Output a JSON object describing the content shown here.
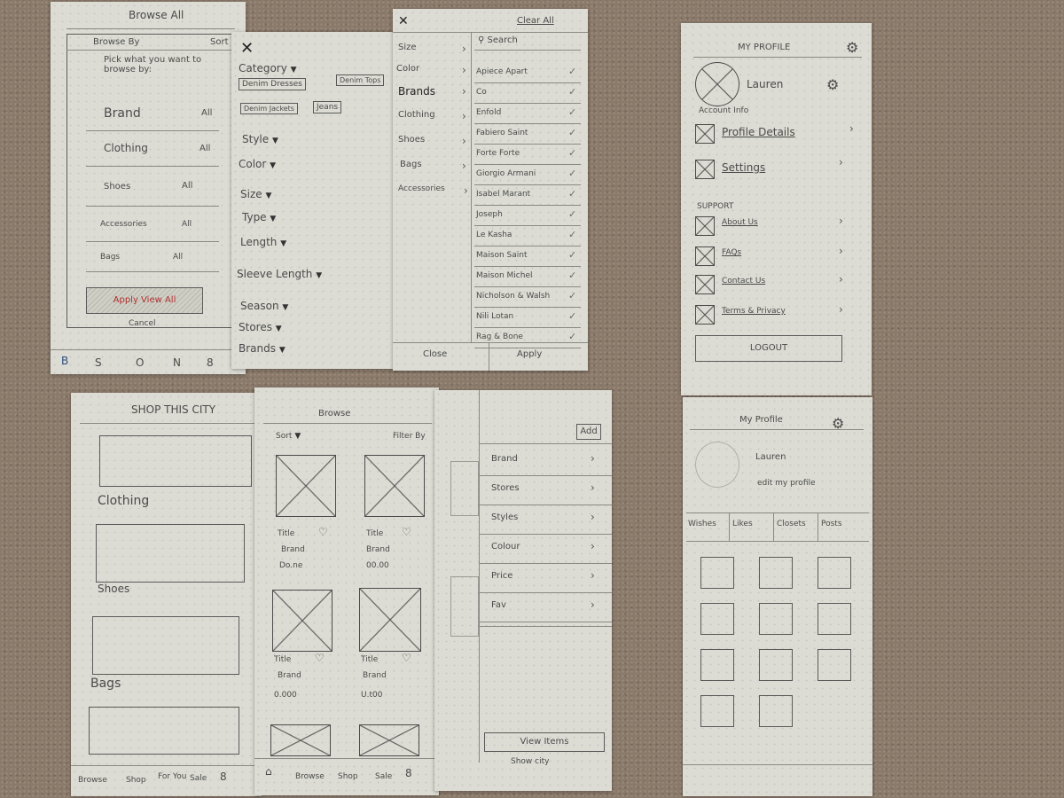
{
  "browse_all": {
    "title": "Browse All",
    "tab_left": "Browse By",
    "tab_right": "Sort",
    "intro": "Pick what you want to browse by:",
    "rows": [
      {
        "label": "Brand",
        "value": "All"
      },
      {
        "label": "Clothing",
        "value": "All"
      },
      {
        "label": "Shoes",
        "value": "All"
      },
      {
        "label": "Accessories",
        "value": "All"
      },
      {
        "label": "Bags",
        "value": "All"
      }
    ],
    "apply": "Apply View All",
    "cancel": "Cancel",
    "bottom_nav": [
      "B",
      "S",
      "O",
      "N",
      "8"
    ]
  },
  "filters": {
    "close_icon": "close-icon",
    "category": "Category",
    "chips": [
      "Denim Dresses",
      "Denim Tops",
      "Denim Jackets",
      "Jeans"
    ],
    "items": [
      "Style",
      "Color",
      "Size",
      "Type",
      "Length",
      "Sleeve Length",
      "Season",
      "Stores",
      "Brands"
    ]
  },
  "brand_picker": {
    "clear_all": "Clear All",
    "search_placeholder": "Search",
    "left_items": [
      "Size",
      "Color",
      "Brands",
      "Clothing",
      "Shoes",
      "Bags",
      "Accessories"
    ],
    "brands": [
      "Apiece Apart",
      "Co",
      "Enfold",
      "Fabiero Saint",
      "Forte Forte",
      "Giorgio Armani",
      "Isabel Marant",
      "Joseph",
      "Le Kasha",
      "Maison Saint",
      "Maison Michel",
      "Nicholson & Walsh",
      "Nili Lotan",
      "Rag & Bone"
    ],
    "close": "Close",
    "apply": "Apply"
  },
  "profile": {
    "title": "MY PROFILE",
    "name": "Lauren",
    "account_info": "Account Info",
    "items": [
      "Profile Details",
      "Settings"
    ],
    "support_label": "SUPPORT",
    "support_items": [
      "About Us",
      "FAQs",
      "Contact Us",
      "Terms & Privacy"
    ],
    "logout": "LOGOUT"
  },
  "shop_city": {
    "title": "SHOP THIS CITY",
    "sections": [
      "Clothing",
      "Shoes",
      "Bags"
    ],
    "nav": [
      "Browse",
      "Shop",
      "For You",
      "Sale",
      "8"
    ]
  },
  "browse_grid": {
    "title": "Browse",
    "sort": "Sort",
    "filter": "Filter By",
    "products": [
      {
        "title": "Title",
        "brand": "Brand",
        "price": "Do.ne"
      },
      {
        "title": "Title",
        "brand": "Brand",
        "price": "00.00"
      },
      {
        "title": "Title",
        "brand": "Brand",
        "price": "0.000"
      },
      {
        "title": "Title",
        "brand": "Brand",
        "price": "U.t00"
      }
    ],
    "nav": [
      "Browse",
      "Shop",
      "Sale",
      "8"
    ]
  },
  "filter_drawer": {
    "add": "Add",
    "items": [
      "Brand",
      "Stores",
      "Styles",
      "Colour",
      "Price",
      "Fav"
    ],
    "view_button": "View Items",
    "footer": "Show city"
  },
  "my_profile2": {
    "title": "My Profile",
    "name": "Lauren",
    "edit": "edit my profile",
    "tabs": [
      "Wishes",
      "Likes",
      "Closets",
      "Posts"
    ]
  }
}
